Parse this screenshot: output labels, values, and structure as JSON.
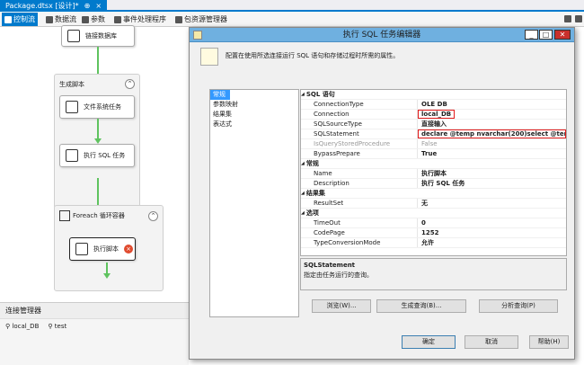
{
  "document": {
    "tab_label": "Package.dtsx [设计]*",
    "pin": "⊕",
    "close": "×"
  },
  "designer_tabs": [
    {
      "label": "控制流",
      "icon": "control-flow-icon",
      "active": true
    },
    {
      "label": "数据流",
      "icon": "data-flow-icon",
      "active": false
    },
    {
      "label": "参数",
      "icon": "parameters-icon",
      "active": false
    },
    {
      "label": "事件处理程序",
      "icon": "event-handlers-icon",
      "active": false
    },
    {
      "label": "包资源管理器",
      "icon": "package-explorer-icon",
      "active": false
    }
  ],
  "canvas": {
    "connect_db": "链接数据库",
    "container_label": "生成脚本",
    "file_task": "文件系统任务",
    "sql_task": "执行 SQL 任务",
    "foreach_label": "Foreach 循环容器",
    "exec_script": "执行脚本",
    "collapse_glyph": "⌃"
  },
  "connection_manager": {
    "title": "连接管理器",
    "items": [
      "local_DB",
      "test"
    ]
  },
  "dialog": {
    "title": "执行 SQL 任务编辑器",
    "description": "配置在使用所选连接运行 SQL 语句和存储过程时所需的属性。",
    "window_buttons": {
      "minimize": "_",
      "maximize": "□",
      "close": "✕"
    },
    "nav": [
      "常规",
      "参数映射",
      "结果集",
      "表达式"
    ],
    "properties": [
      {
        "cat": true,
        "name": "SQL 语句"
      },
      {
        "name": "ConnectionType",
        "value": "OLE DB"
      },
      {
        "name": "Connection",
        "value": "local_DB",
        "highlight": true
      },
      {
        "name": "SQLSourceType",
        "value": "直接输入"
      },
      {
        "name": "SQLStatement",
        "value": "declare @temp nvarchar(200)select @temp",
        "highlight": true
      },
      {
        "name": "IsQueryStoredProcedure",
        "value": "False",
        "disabled": true
      },
      {
        "name": "BypassPrepare",
        "value": "True"
      },
      {
        "cat": true,
        "name": "常规"
      },
      {
        "name": "Name",
        "value": "执行脚本"
      },
      {
        "name": "Description",
        "value": "执行 SQL 任务"
      },
      {
        "cat": true,
        "name": "结果集"
      },
      {
        "name": "ResultSet",
        "value": "无"
      },
      {
        "cat": true,
        "name": "选项"
      },
      {
        "name": "TimeOut",
        "value": "0"
      },
      {
        "name": "CodePage",
        "value": "1252"
      },
      {
        "name": "TypeConversionMode",
        "value": "允许"
      }
    ],
    "prop_desc": {
      "title": "SQLStatement",
      "text": "指定由任务运行的查询。"
    },
    "buttons": {
      "browse": "浏览(W)...",
      "build_query": "生成查询(B)...",
      "parse_query": "分析查询(P)",
      "ok": "确定",
      "cancel": "取消",
      "help": "帮助(H)"
    }
  }
}
